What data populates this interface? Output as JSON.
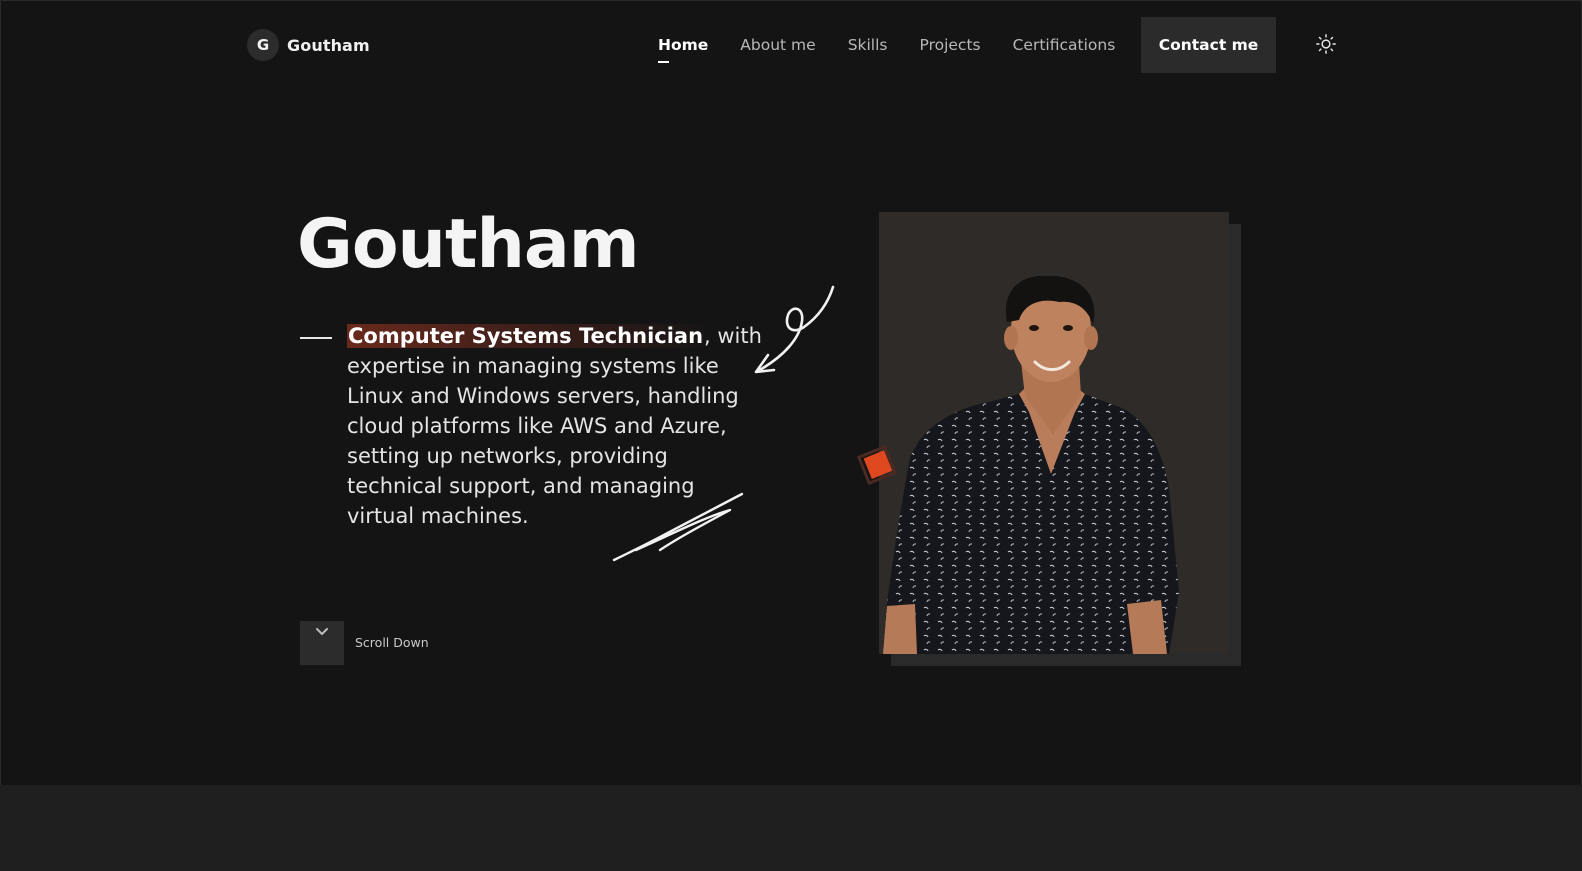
{
  "nav": {
    "logo_letter": "G",
    "logo_name": "Goutham",
    "links": [
      {
        "label": "Home",
        "active": true
      },
      {
        "label": "About me",
        "active": false
      },
      {
        "label": "Skills",
        "active": false
      },
      {
        "label": "Projects",
        "active": false
      },
      {
        "label": "Certifications",
        "active": false
      }
    ],
    "contact_label": "Contact me",
    "theme_icon": "sun-icon"
  },
  "hero": {
    "name": "Goutham",
    "role": "Computer Systems Technician",
    "description": ", with expertise in managing systems like Linux and Windows servers, handling cloud platforms like AWS and Azure, setting up networks, providing technical support, and managing virtual machines.",
    "scroll_label": "Scroll Down",
    "scroll_icon": "chevron-down-icon"
  },
  "colors": {
    "background": "#141414",
    "accent": "#e0491f",
    "button_bg": "#2b2b2b",
    "photo_bg": "#2f2b28"
  }
}
